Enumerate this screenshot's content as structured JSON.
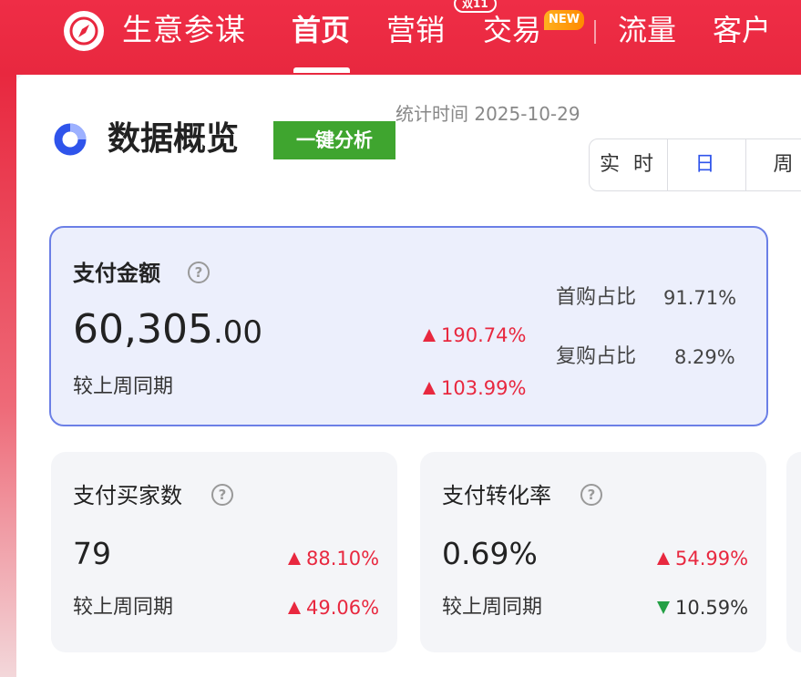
{
  "app": {
    "name": "生意参谋"
  },
  "nav": {
    "items": [
      {
        "label": "首页",
        "active": true
      },
      {
        "label": "营销"
      },
      {
        "label": "交易"
      },
      {
        "label": "流量"
      },
      {
        "label": "客户"
      }
    ],
    "event_badge": "双11",
    "new_badge": "NEW"
  },
  "overview": {
    "title": "数据概览",
    "analyze_button": "一键分析",
    "stat_time": "统计时间 2025-10-29",
    "periods": [
      "实 时",
      "日",
      "周"
    ],
    "selected_period": "日"
  },
  "payment_amount": {
    "label": "支付金额",
    "value_int": "60,305",
    "value_dec": ".00",
    "trend_day": "190.74%",
    "compare_label": "较上周同期",
    "trend_week": "103.99%",
    "first_purchase_label": "首购占比",
    "first_purchase_value": "91.71%",
    "repeat_purchase_label": "复购占比",
    "repeat_purchase_value": "8.29%"
  },
  "buyers": {
    "label": "支付买家数",
    "value": "79",
    "trend_day": "88.10%",
    "compare_label": "较上周同期",
    "trend_week": "49.06%"
  },
  "conversion": {
    "label": "支付转化率",
    "value": "0.69%",
    "trend_day": "54.99%",
    "compare_label": "较上周同期",
    "trend_week": "10.59%"
  },
  "colors": {
    "brand_red": "#e8283f",
    "accent_blue": "#2f54eb",
    "analyze_green": "#3fa52f",
    "down_green": "#24a045"
  }
}
